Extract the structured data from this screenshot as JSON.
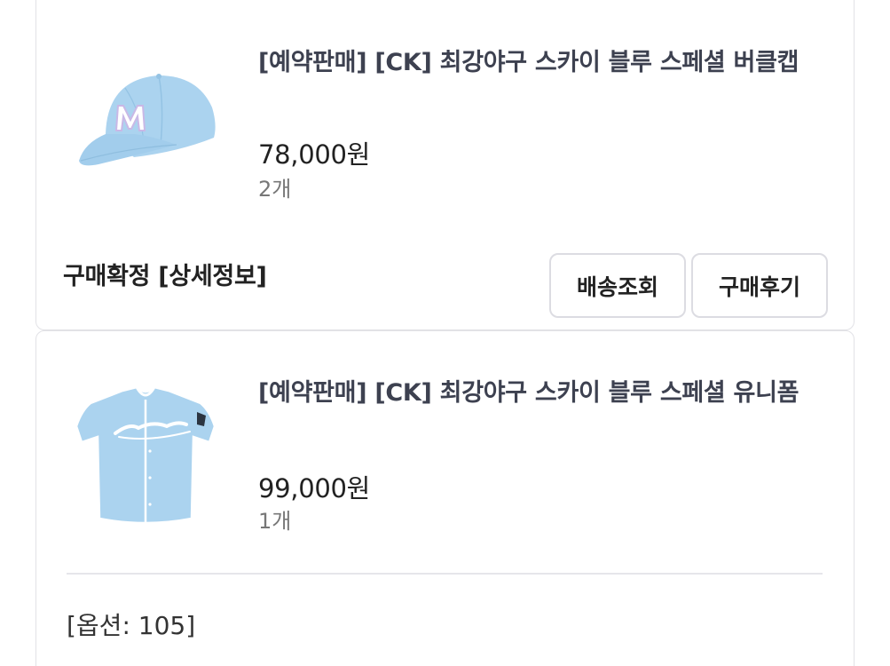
{
  "orders": [
    {
      "title": "[예약판매] [CK] 최강야구 스카이 블루 스페셜 버클캡",
      "price": "78,000원",
      "quantity": "2개",
      "image_icon": "sky-blue-baseball-cap",
      "status_label": "구매확정",
      "detail_link": "[상세정보]",
      "buttons": {
        "track": "배송조회",
        "review": "구매후기"
      }
    },
    {
      "title": "[예약판매] [CK] 최강야구 스카이 블루 스페셜 유니폼",
      "price": "99,000원",
      "quantity": "1개",
      "image_icon": "sky-blue-baseball-jersey",
      "option": "[옵션: 105]"
    }
  ],
  "colors": {
    "title": "#3d4150",
    "product_sky_blue": "#a9d3ef",
    "border": "#e2e2e6"
  }
}
